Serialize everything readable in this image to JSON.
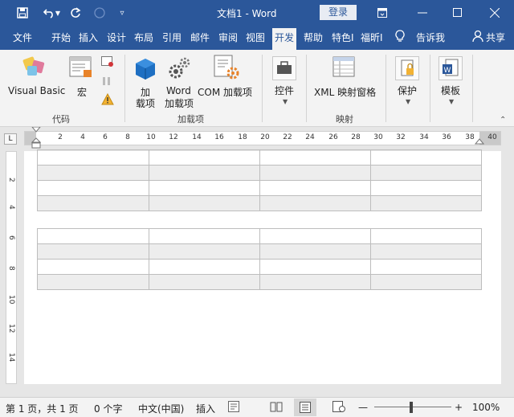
{
  "titlebar": {
    "title": "文档1  -  Word",
    "login": "登录"
  },
  "tabs": [
    "文件",
    "开始",
    "插入",
    "设计",
    "布局",
    "引用",
    "邮件",
    "审阅",
    "视图",
    "开发",
    "帮助",
    "特色I",
    "福昕I"
  ],
  "tellme": "告诉我",
  "share": "共享",
  "ribbon": {
    "visual_basic": "Visual Basic",
    "macro": "宏",
    "addins_1": "加",
    "addins_2": "载项",
    "word_addins_1": "Word",
    "word_addins_2": "加载项",
    "com_addins": "COM 加载项",
    "controls": "控件",
    "xml_mapping": "XML 映射窗格",
    "protect": "保护",
    "template": "模板",
    "group_code": "代码",
    "group_addins": "加载项",
    "group_mapping": "映射"
  },
  "ruler": {
    "corner": "L",
    "marks": [
      "2",
      "4",
      "6",
      "8",
      "10",
      "12",
      "14",
      "16",
      "18",
      "20",
      "22",
      "24",
      "26",
      "28",
      "30",
      "32",
      "34",
      "36",
      "38",
      "40"
    ],
    "vmarks": [
      "2",
      "4",
      "6",
      "8",
      "10",
      "12",
      "14"
    ]
  },
  "status": {
    "page": "第 1 页，共 1 页",
    "words": "0 个字",
    "lang": "中文(中国)",
    "insert": "插入",
    "zoom_minus": "—",
    "zoom_plus": "+",
    "zoom": "100%"
  },
  "colors": {
    "accent": "#2b579a",
    "ribbon_bg": "#f3f3f3",
    "canvas_bg": "#e6e6e6"
  }
}
